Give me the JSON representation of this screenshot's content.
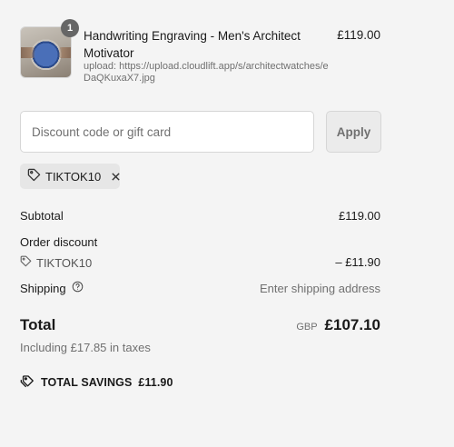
{
  "product": {
    "quantity": "1",
    "title": "Handwriting Engraving - Men's Architect Motivator",
    "meta": "upload: https://upload.cloudlift.app/s/architectwatches/eDaQKuxaX7.jpg",
    "price": "£119.00"
  },
  "discount": {
    "placeholder": "Discount code or gift card",
    "value": "",
    "apply_label": "Apply",
    "applied_code": "TIKTOK10"
  },
  "summary": {
    "subtotal_label": "Subtotal",
    "subtotal_value": "£119.00",
    "order_discount_label": "Order discount",
    "discount_code": "TIKTOK10",
    "discount_value": "– £11.90",
    "shipping_label": "Shipping",
    "shipping_value": "Enter shipping address",
    "total_label": "Total",
    "currency": "GBP",
    "total_value": "£107.10",
    "tax_note": "Including £17.85 in taxes",
    "savings_label": "TOTAL SAVINGS",
    "savings_value": "£11.90"
  },
  "icons": {
    "tag": "tag-icon",
    "close": "close-icon",
    "help": "help-circle-icon",
    "savings": "savings-tag-icon"
  },
  "colors": {
    "background": "#f4f4f4",
    "muted_text": "#707070",
    "badge": "#666666"
  }
}
